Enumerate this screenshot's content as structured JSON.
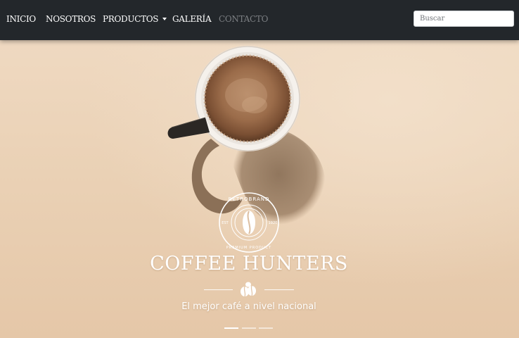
{
  "nav": {
    "items": [
      {
        "label": "INICIO"
      },
      {
        "label": "NOSOTROS"
      },
      {
        "label": "PRODUCTOS"
      },
      {
        "label": "GALERÍA"
      },
      {
        "label": "CONTACTO"
      }
    ],
    "search_placeholder": "Buscar"
  },
  "hero": {
    "logo": {
      "top_text": "RETROBRAND",
      "bottom_text": "PREMIUM PRODUCT",
      "left_text": "EST",
      "right_text": "1920"
    },
    "title": "COFFEE HUNTERS",
    "subtitle": "El mejor café a nivel nacional",
    "carousel": {
      "slide_count": 3,
      "active_slide": 1
    }
  },
  "colors": {
    "navbar_bg": "#23272b",
    "nav_text": "#ffffff",
    "nav_muted": "#7c7f83",
    "hero_bg": "#ead4bb"
  },
  "icons": [
    "caret-down-icon",
    "coffee-beans-icon",
    "coffee-logo-icon"
  ]
}
